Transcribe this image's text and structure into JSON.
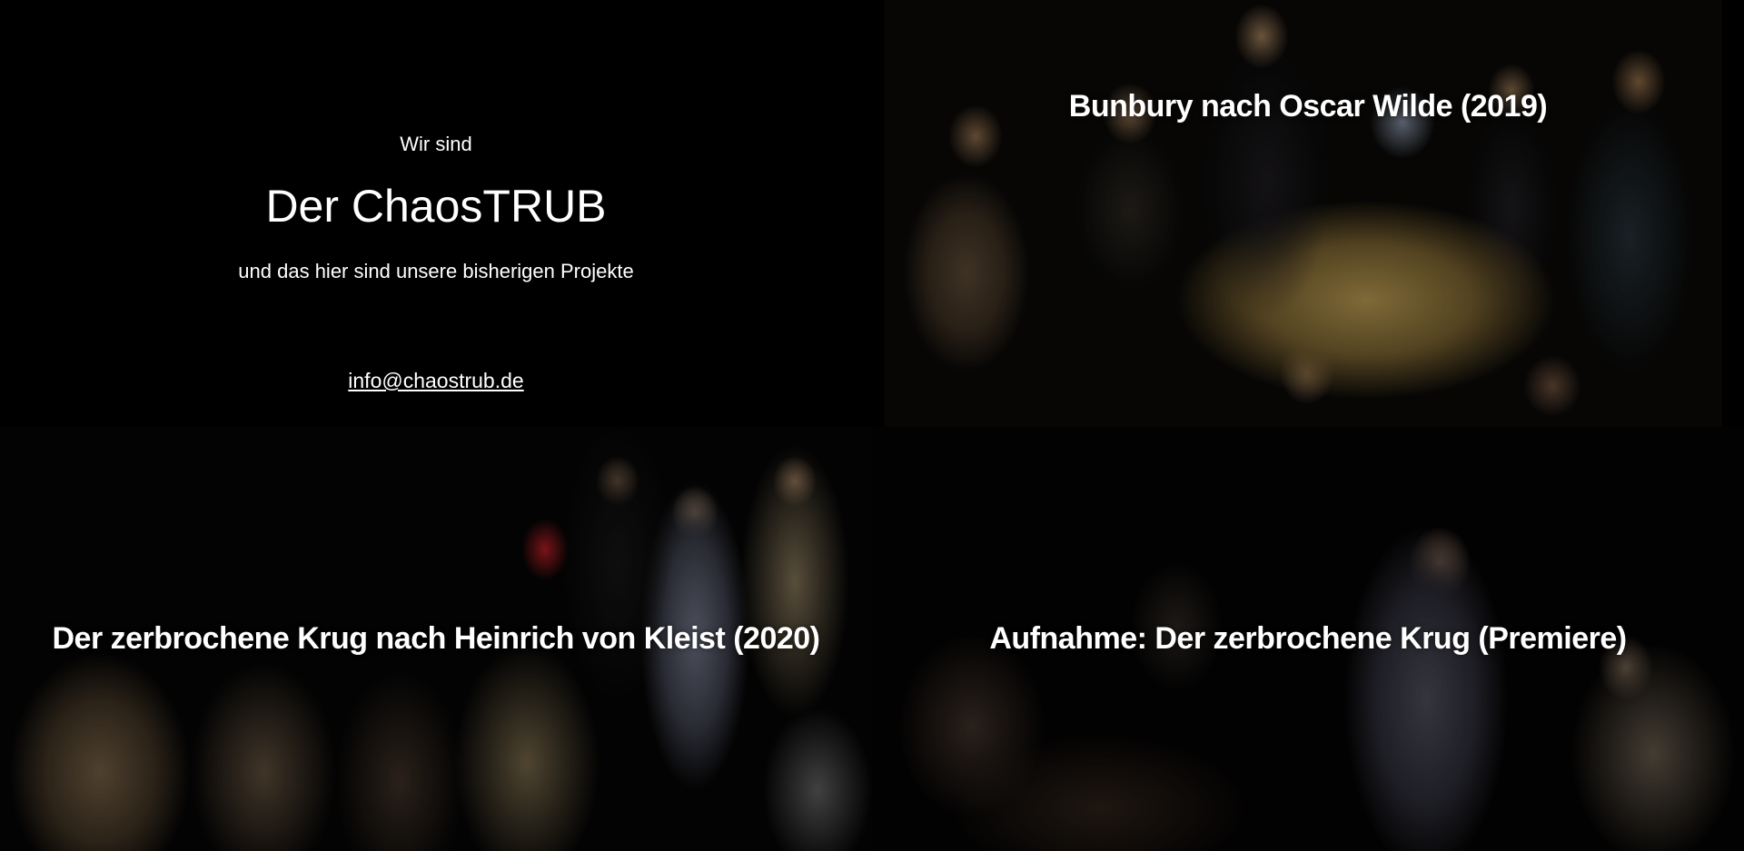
{
  "intro": {
    "pre_title": "Wir sind",
    "title": "Der ChaosTRUB",
    "subtitle": "und das hier sind unsere bisherigen Projekte",
    "email": "info@chaostrub.de"
  },
  "projects": [
    {
      "title": "Bunbury nach Oscar Wilde (2019)"
    },
    {
      "title": "Der zerbrochene Krug nach Heinrich von Kleist (2020)"
    },
    {
      "title": "Aufnahme: Der zerbrochene Krug (Premiere)"
    }
  ]
}
